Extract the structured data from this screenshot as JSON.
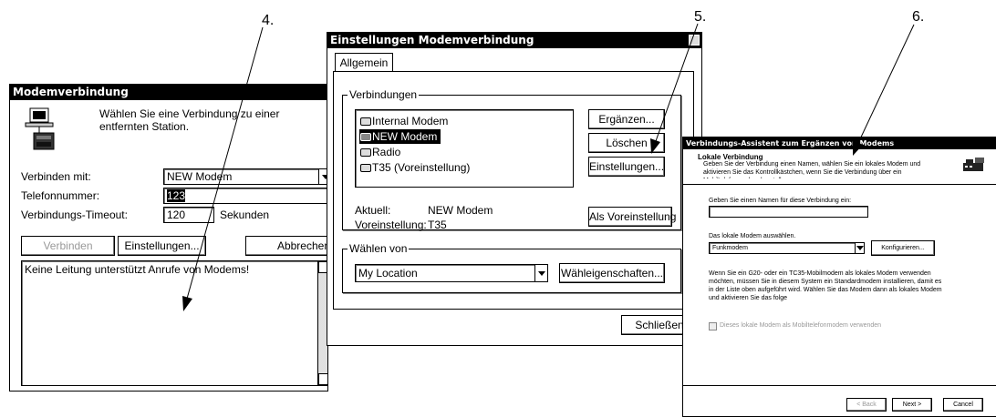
{
  "callouts": {
    "c4": "4.",
    "c5": "5.",
    "c6": "6."
  },
  "win1": {
    "title": "Modemverbindung",
    "intro": "Wählen Sie eine Verbindung zu einer entfernten Station.",
    "connect_with_label": "Verbinden mit:",
    "connect_with_value": "NEW Modem",
    "phone_label": "Telefonnummer:",
    "phone_value": "123",
    "timeout_label": "Verbindungs-Timeout:",
    "timeout_value": "120",
    "timeout_unit": "Sekunden",
    "btn_connect": "Verbinden",
    "btn_settings": "Einstellungen...",
    "btn_cancel": "Abbrechen",
    "log_text": "Keine Leitung unterstützt Anrufe von Modems!"
  },
  "win2": {
    "title": "Einstellungen Modemverbindung",
    "tab": "Allgemein",
    "group_connections": "Verbindungen",
    "connections": [
      "Internal Modem",
      "NEW Modem",
      "Radio",
      "T35 (Voreinstellung)"
    ],
    "selected_index": 1,
    "btn_add": "Ergänzen...",
    "btn_delete": "Löschen",
    "btn_settings": "Einstellungen...",
    "btn_default": "Als Voreinstellung",
    "current_label": "Aktuell:",
    "current_value": "NEW Modem",
    "default_label": "Voreinstellung:",
    "default_value": "T35",
    "group_dial": "Wählen von",
    "dial_location": "My Location",
    "btn_dial_props": "Wähleigenschaften...",
    "btn_close": "Schließen"
  },
  "win3": {
    "title": "Verbindungs-Assistent zum Ergänzen von Modems",
    "header_title": "Lokale Verbindung",
    "header_desc": "Geben Sie der Verbindung einen Namen, wählen Sie ein lokales Modem und aktivieren Sie das Kontrollkästchen, wenn Sie die Verbindung über ein Mobiltelefonmodem herstellen.",
    "name_label": "Geben Sie einen Namen für diese Verbindung ein:",
    "name_value": "",
    "modem_label": "Das lokale Modem auswählen.",
    "modem_value": "Funkmodem",
    "btn_configure": "Konfigurieren...",
    "info_text": "Wenn Sie ein G20- oder ein TC35-Mobilmodem als lokales Modem verwenden möchten, müssen Sie in diesem System ein Standardmodem installieren, damit es in der Liste oben aufgeführt wird. Wählen Sie das Modem dann als lokales Modem und aktivieren Sie das folge",
    "checkbox_label": "Dieses lokale Modem als Mobiltelefonmodem verwenden",
    "btn_back": "< Back",
    "btn_next": "Next >",
    "btn_cancel": "Cancel"
  }
}
